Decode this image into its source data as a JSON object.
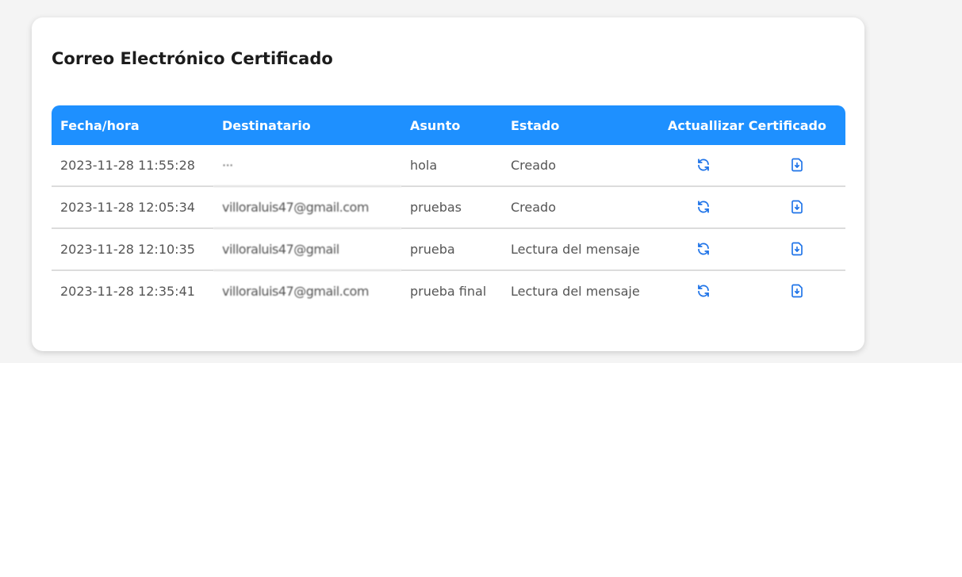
{
  "card": {
    "title": "Correo Electrónico Certificado"
  },
  "table": {
    "headers": {
      "fecha": "Fecha/hora",
      "destinatario": "Destinatario",
      "asunto": "Asunto",
      "estado": "Estado",
      "actions": "Actuallizar Certificado"
    },
    "rows": [
      {
        "fecha": "2023-11-28 11:55:28",
        "destinatario": "···",
        "asunto": "hola",
        "estado": "Creado",
        "refresh_icon": "refresh-icon",
        "download_icon": "file-download-icon"
      },
      {
        "fecha": "2023-11-28 12:05:34",
        "destinatario": "villoraluis47@gmail.com",
        "asunto": "pruebas",
        "estado": "Creado",
        "refresh_icon": "refresh-icon",
        "download_icon": "file-download-icon"
      },
      {
        "fecha": "2023-11-28 12:10:35",
        "destinatario": "villoraluis47@gmail",
        "asunto": "prueba",
        "estado": "Lectura del mensaje",
        "refresh_icon": "refresh-icon",
        "download_icon": "file-download-icon"
      },
      {
        "fecha": "2023-11-28 12:35:41",
        "destinatario": "villoraluis47@gmail.com",
        "asunto": "prueba final",
        "estado": "Lectura del mensaje",
        "refresh_icon": "refresh-icon",
        "download_icon": "file-download-icon"
      }
    ]
  },
  "colors": {
    "header_bg": "#1e90ff",
    "icon": "#1e73e8",
    "card_bg": "#ffffff",
    "page_bg": "#f4f4f4"
  }
}
